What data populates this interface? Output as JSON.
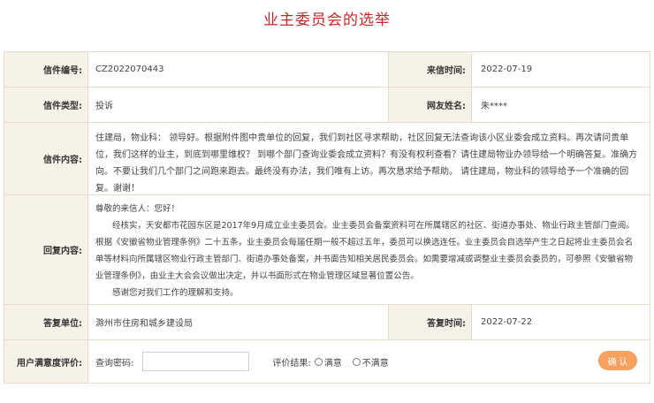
{
  "page_title": "业主委员会的选举",
  "letter": {
    "number_label": "信件编号:",
    "number": "CZ2022070443",
    "date_label": "来信时间:",
    "date": "2022-07-19",
    "type_label": "信件类型:",
    "type": "投诉",
    "user_label": "网友姓名:",
    "user": "朱****",
    "content_label": "信件内容:",
    "content": "住建局，物业科： 领导好。根据附件图中贵单位的回复，我们到社区寻求帮助，社区回复无法查询该小区业委会成立资料。再次请问贵单位，我们这样的业主，到底到哪里维权？ 到哪个部门查询业委会成立资料？有没有权利查看？请住建局物业办领导给一个明确答复。准确方向。不要让我们几个部门之间跑来跑去。最终没有办法，我们唯有上访。再次恳求给予帮助。 请住建局，物业科的领导给予一个准确的回复。谢谢！"
  },
  "reply": {
    "label": "回复内容:",
    "greeting": "尊敬的来信人：您好！",
    "body": "经核实，天安都市花园东区是2017年9月成立业主委员会。业主委员会备案资料可在所属辖区的社区、街道办事处、物业行政主管部门查阅。根据《安徽省物业管理条例》二十五条，业主委员会每届任期一般不超过五年，委员可以换选连任。业主委员会自选举产生之日起将业主委员会名单等材料向所属辖区物业行政主管部门、街道办事处备案，并书面告知相关居民委员会。如需要增减或调整业主委员会委员的，可参照《安徽省物业管理条例》，由业主大会会议做出决定，并以书面形式在物业管理区域显著位置公告。",
    "closing": "感谢您对我们工作的理解和支持。",
    "unit_label": "答复单位:",
    "unit": "滁州市住房和城乡建设局",
    "date_label": "答复时间:",
    "date": "2022-07-22"
  },
  "evaluation": {
    "label": "用户满意度评价:",
    "password_label": "查询密码:",
    "password_value": "",
    "result_label": "评价结果:",
    "options": [
      "满意",
      "不满意"
    ],
    "confirm_label": "确 认"
  }
}
